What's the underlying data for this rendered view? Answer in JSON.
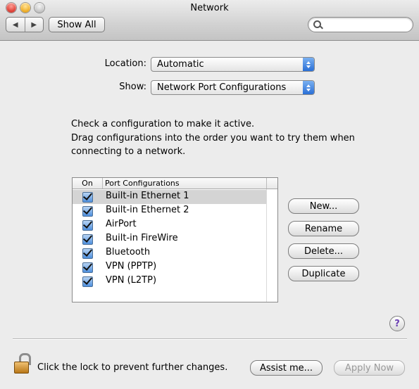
{
  "window": {
    "title": "Network"
  },
  "toolbar": {
    "back_icon": "◀",
    "forward_icon": "▶",
    "show_all_label": "Show All",
    "search_value": ""
  },
  "location": {
    "label": "Location:",
    "value": "Automatic"
  },
  "show": {
    "label": "Show:",
    "value": "Network Port Configurations"
  },
  "instructions": {
    "line1": "Check a configuration to make it active.",
    "line2": "Drag configurations into the order you want to try them when",
    "line3": "connecting to a network."
  },
  "table": {
    "columns": [
      "On",
      "Port Configurations"
    ],
    "rows": [
      {
        "checked": true,
        "name": "Built-in Ethernet 1",
        "selected": true
      },
      {
        "checked": true,
        "name": "Built-in Ethernet 2",
        "selected": false
      },
      {
        "checked": true,
        "name": "AirPort",
        "selected": false
      },
      {
        "checked": true,
        "name": "Built-in FireWire",
        "selected": false
      },
      {
        "checked": true,
        "name": "Bluetooth",
        "selected": false
      },
      {
        "checked": true,
        "name": "VPN (PPTP)",
        "selected": false
      },
      {
        "checked": true,
        "name": "VPN (L2TP)",
        "selected": false
      }
    ]
  },
  "actions": {
    "new_label": "New...",
    "rename_label": "Rename",
    "delete_label": "Delete...",
    "duplicate_label": "Duplicate"
  },
  "help": {
    "label": "?"
  },
  "footer": {
    "lock_text": "Click the lock to prevent further changes.",
    "assist_label": "Assist me...",
    "apply_label": "Apply Now"
  }
}
